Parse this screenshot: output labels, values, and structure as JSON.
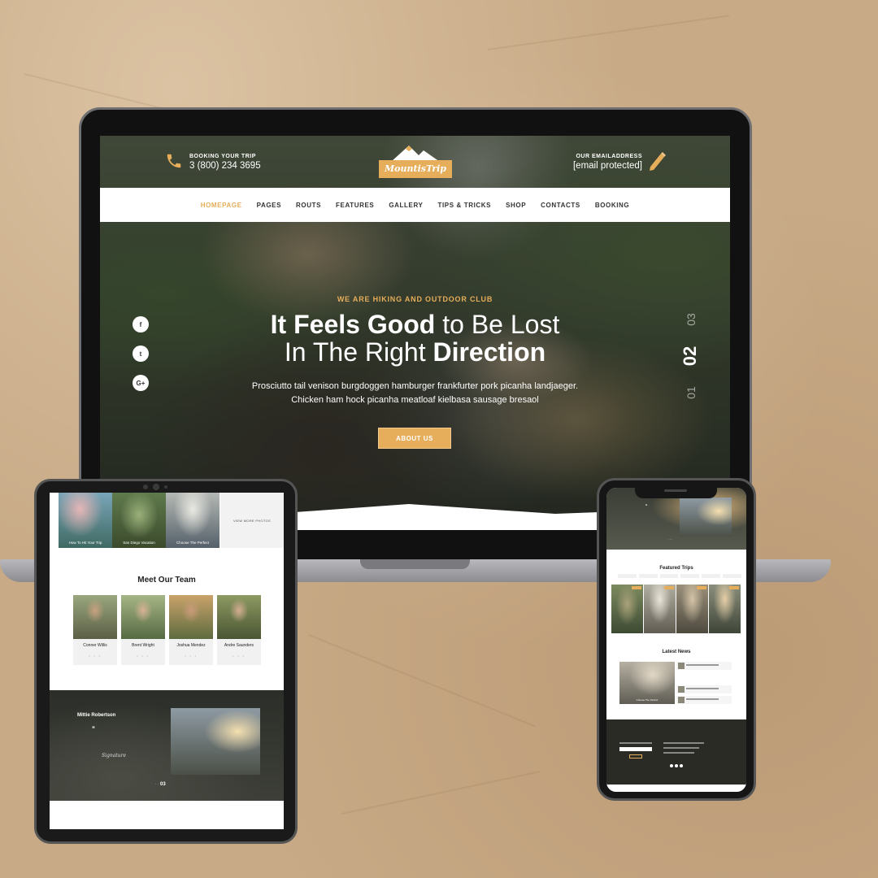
{
  "laptop": {
    "topbar": {
      "booking_label": "BOOKING YOUR TRIP",
      "booking_phone": "3 (800) 234 3695",
      "logo_text": "MountisTrip",
      "email_label": "OUR EMAILADDRESS",
      "email_value": "[email protected]"
    },
    "nav": [
      "HOMEPAGE",
      "PAGES",
      "ROUTS",
      "FEATURES",
      "GALLERY",
      "TIPS & TRICKS",
      "SHOP",
      "CONTACTS",
      "BOOKING"
    ],
    "nav_active": "HOMEPAGE",
    "social_icons": [
      "facebook-icon",
      "twitter-icon",
      "google-plus-icon"
    ],
    "social_labels": [
      "f",
      "t",
      "G+"
    ],
    "hero": {
      "eyebrow": "WE ARE HIKING AND OUTDOOR CLUB",
      "headline_bold_1": "It Feels Good",
      "headline_rest_1": " to Be Lost",
      "headline_rest_2": "In The Right ",
      "headline_bold_2": "Direction",
      "body_line_1": "Prosciutto tail venison burgdoggen hamburger frankfurter pork picanha landjaeger.",
      "body_line_2": "Chicken ham hock picanha meatloaf kielbasa sausage bresaol",
      "button": "ABOUT US"
    },
    "slides": {
      "previous": "01",
      "current": "02",
      "next": "03"
    }
  },
  "tablet": {
    "gallery": [
      "How To Hit Your Trip",
      "San Diego Vacation",
      "Choose The Perfect"
    ],
    "view_more": "VIEW MORE PHOTOS",
    "team_title": "Meet Our Team",
    "team": [
      {
        "name": "Conner Willis"
      },
      {
        "name": "Brent Wright"
      },
      {
        "name": "Joshua Mendez"
      },
      {
        "name": "Andre Saunders"
      }
    ],
    "testimonial": {
      "name": "Mittie Robertson",
      "quote_mark": "“",
      "signature": "Signature",
      "pag_current": "03"
    }
  },
  "phone": {
    "featured_title": "Featured Trips",
    "news_title": "Latest News",
    "news_caption": "Choose The Perfect"
  },
  "colors": {
    "accent": "#e6ad5a",
    "background": "#c8aa86",
    "device_frame": "#111111"
  }
}
